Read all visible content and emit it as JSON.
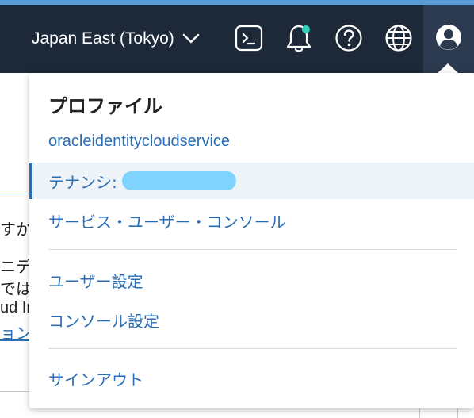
{
  "header": {
    "region_label": "Japan East (Tokyo)",
    "icons": [
      "cloud-shell-icon",
      "bell-icon",
      "help-icon",
      "globe-icon",
      "user-icon"
    ],
    "notification_dot_color": "#34d1b7"
  },
  "page_fragments": {
    "line1": "すか",
    "line2": "ニデし",
    "line3": "では",
    "line4": "ud In",
    "line5": "ョン"
  },
  "profile_menu": {
    "title": "プロファイル",
    "user": "oracleidentitycloudservice",
    "tenancy_label": "テナンシ:",
    "service_user_console": "サービス・ユーザー・コンソール",
    "user_settings": "ユーザー設定",
    "console_settings": "コンソール設定",
    "sign_out": "サインアウト"
  },
  "colors": {
    "topbar": "#1d2838",
    "accent": "#5b9bd5",
    "link": "#2a6db5",
    "selected_row": "#eef3f8"
  }
}
